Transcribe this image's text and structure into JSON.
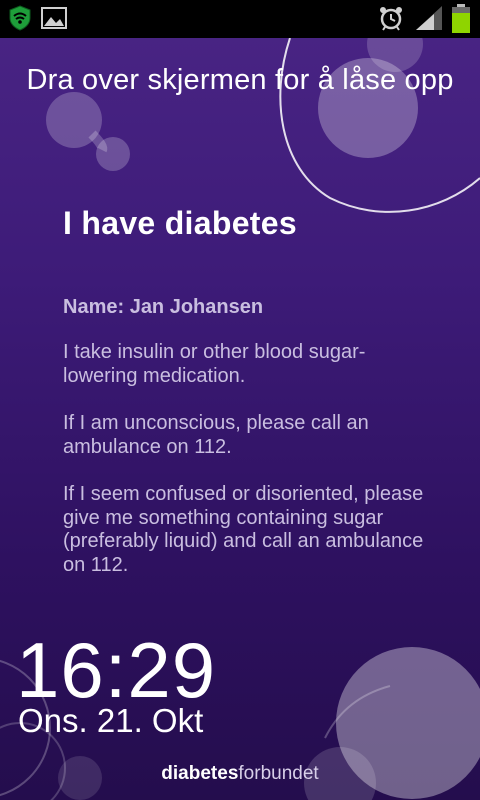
{
  "status_bar": {
    "left_icons": [
      "shield-wifi-icon",
      "image-icon"
    ],
    "right_icons": [
      "alarm-clock-icon",
      "signal-strength-icon",
      "battery-icon"
    ],
    "colors": {
      "background": "#000000",
      "shield": "#1e9e3a",
      "battery": "#8fd400"
    }
  },
  "lockscreen": {
    "unlock_hint": "Dra over skjermen for å låse opp"
  },
  "card": {
    "title": "I have diabetes",
    "name": "Name: Jan Johansen",
    "paragraphs": [
      "I take insulin or other blood sugar-lowering medication.",
      "If I am unconscious, please call an ambulance on 112.",
      "If I seem confused or disoriented, please give me something containing sugar (preferably liquid) and call an ambulance on 112."
    ]
  },
  "clock": {
    "time": "16:29",
    "date": "Ons. 21. Okt"
  },
  "brand": {
    "bold": "diabetes",
    "light": "forbundet"
  },
  "colors": {
    "background_top": "#4a2585",
    "background_bottom": "#240d4d",
    "body_text": "#c9bee0",
    "heading_text": "#ffffff"
  }
}
